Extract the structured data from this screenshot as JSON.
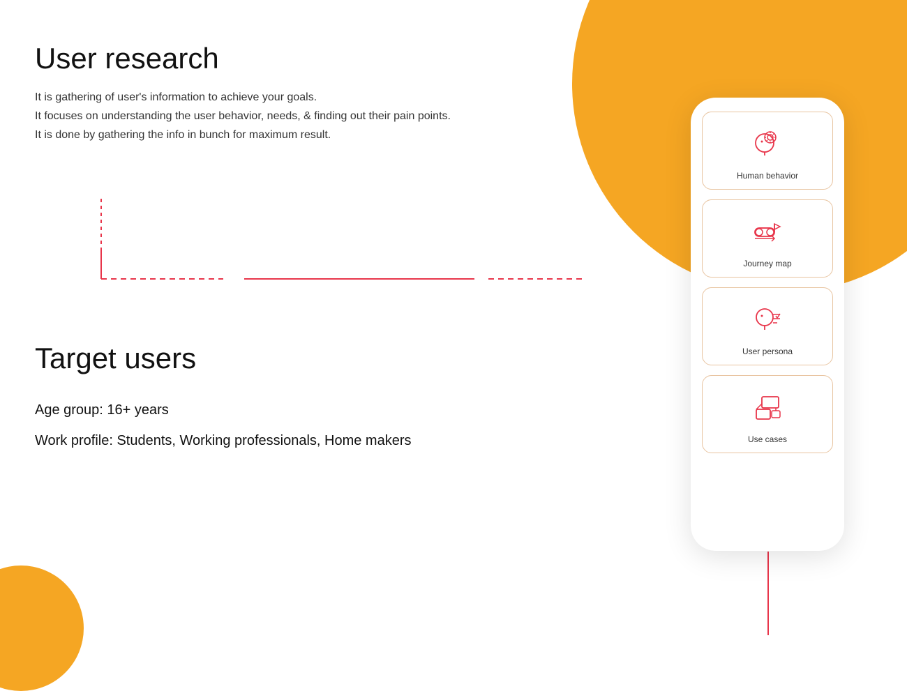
{
  "page": {
    "background": "#ffffff"
  },
  "user_research": {
    "title": "User research",
    "description_lines": [
      "It is gathering of user's information to achieve your goals.",
      "It focuses on understanding the user behavior, needs, & finding out their pain points.",
      "It is done by gathering the info in bunch for maximum result."
    ]
  },
  "target_users": {
    "title": "Target users",
    "age_group": "Age group: 16+ years",
    "work_profile": "Work profile: Students, Working professionals, Home makers"
  },
  "phone_cards": [
    {
      "label": "Human behavior",
      "icon": "human-behavior-icon"
    },
    {
      "label": "Journey map",
      "icon": "journey-map-icon"
    },
    {
      "label": "User persona",
      "icon": "user-persona-icon"
    },
    {
      "label": "Use cases",
      "icon": "use-cases-icon"
    }
  ],
  "colors": {
    "orange": "#F5A623",
    "red": "#e8354a",
    "dark": "#111111",
    "text": "#333333"
  }
}
